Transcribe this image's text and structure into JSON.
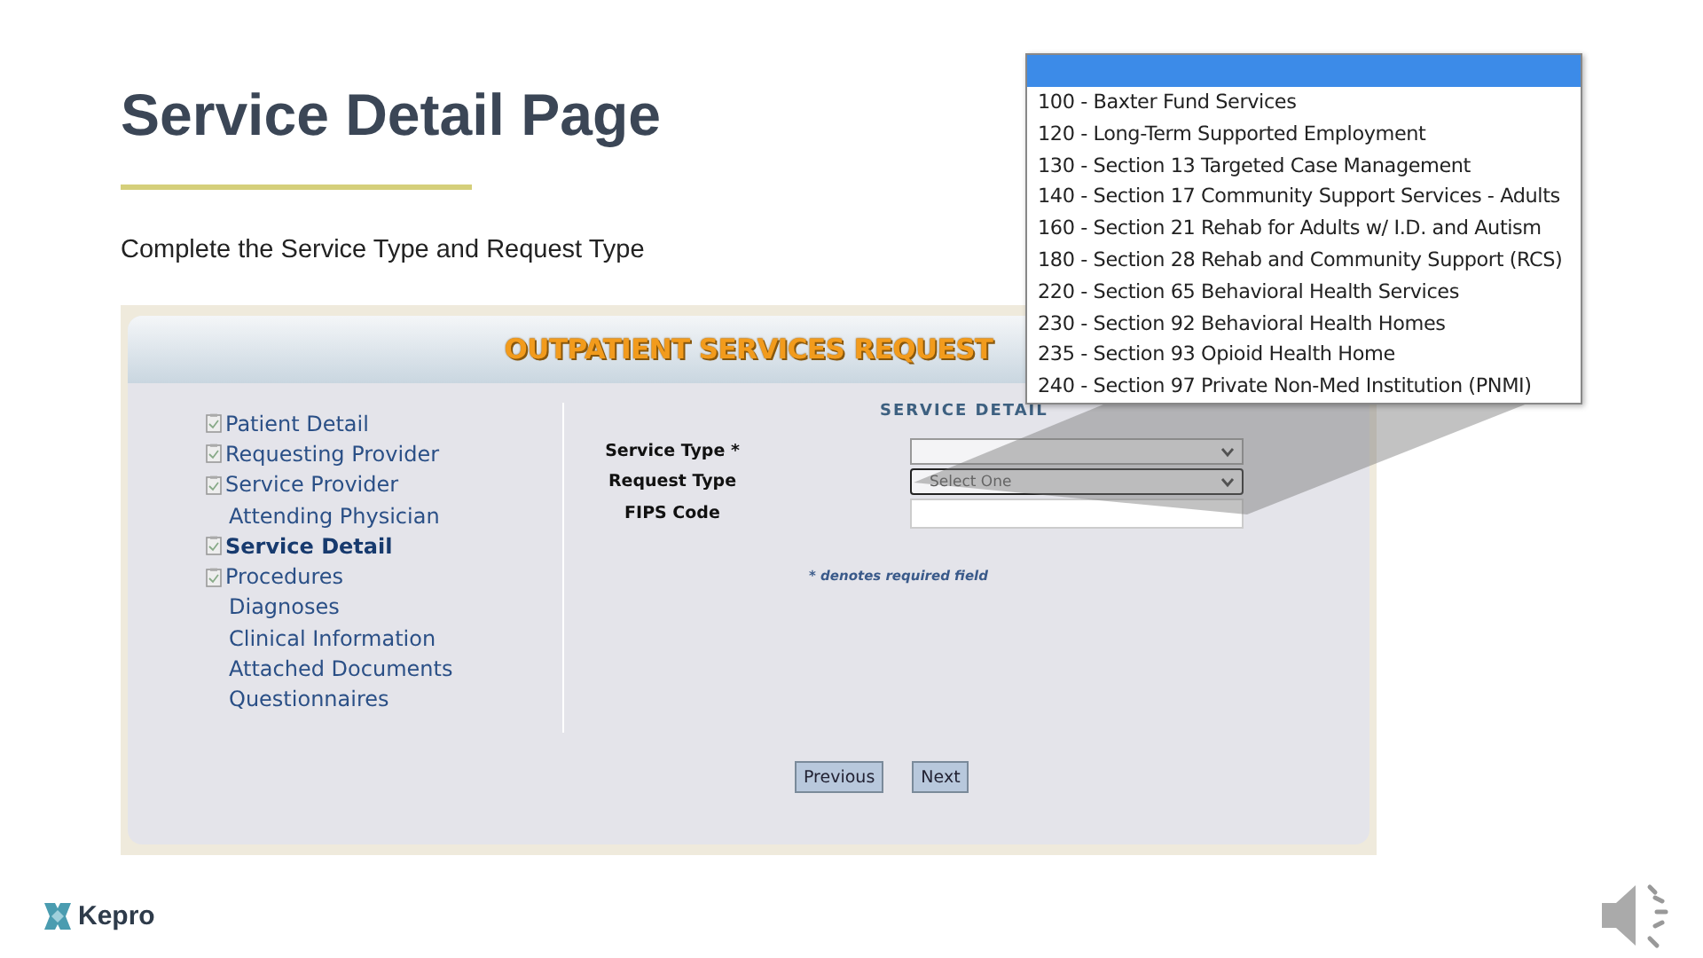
{
  "slide": {
    "title": "Service Detail Page",
    "subtitle": "Complete the Service Type and Request Type"
  },
  "app": {
    "header": "OUTPATIENT SERVICES REQUEST",
    "nav": [
      {
        "label": "Patient Detail",
        "kind": "document",
        "selected": false
      },
      {
        "label": "Requesting Provider",
        "kind": "document",
        "selected": false
      },
      {
        "label": "Service Provider",
        "kind": "document",
        "selected": false
      },
      {
        "label": "Attending Physician",
        "kind": "plain",
        "selected": false
      },
      {
        "label": "Service Detail",
        "kind": "document",
        "selected": true
      },
      {
        "label": "Procedures",
        "kind": "document",
        "selected": false
      },
      {
        "label": "Diagnoses",
        "kind": "plain",
        "selected": false
      },
      {
        "label": "Clinical Information",
        "kind": "plain",
        "selected": false
      },
      {
        "label": "Attached Documents",
        "kind": "plain",
        "selected": false
      },
      {
        "label": "Questionnaires",
        "kind": "plain",
        "selected": false
      }
    ],
    "section_title": "SERVICE DETAIL",
    "fields": [
      {
        "label": "Service Type *",
        "kind": "select",
        "focused": false
      },
      {
        "label": "Request Type",
        "kind": "select",
        "value": "Select One",
        "focused": true
      },
      {
        "label": "FIPS Code",
        "kind": "text",
        "focused": false
      }
    ],
    "note": "* denotes required field",
    "buttons": [
      "Previous",
      "Next"
    ]
  },
  "dropdown": {
    "blank_option_selected": true,
    "options": [
      {
        "label": "100 - Baxter Fund Services"
      },
      {
        "label": "120 - Long-Term Supported Employment"
      },
      {
        "label": "130 - Section 13 Targeted Case Management"
      },
      {
        "label": "140 - Section 17 Community Support Services -  Adults"
      },
      {
        "label": "160 - Section 21 Rehab for Adults w/ I.D. and Autism"
      },
      {
        "label": "180 - Section 28 Rehab and Community Support (RCS)"
      },
      {
        "label": "220 - Section 65 Behavioral Health Services"
      },
      {
        "label": "230 - Section 92 Behavioral Health Homes"
      },
      {
        "label": "235 - Section 93 Opioid Health Home"
      },
      {
        "label": "240 - Section 97 Private Non-Med Institution (PNMI)"
      }
    ]
  },
  "footer": {
    "logo": "Kepro"
  }
}
